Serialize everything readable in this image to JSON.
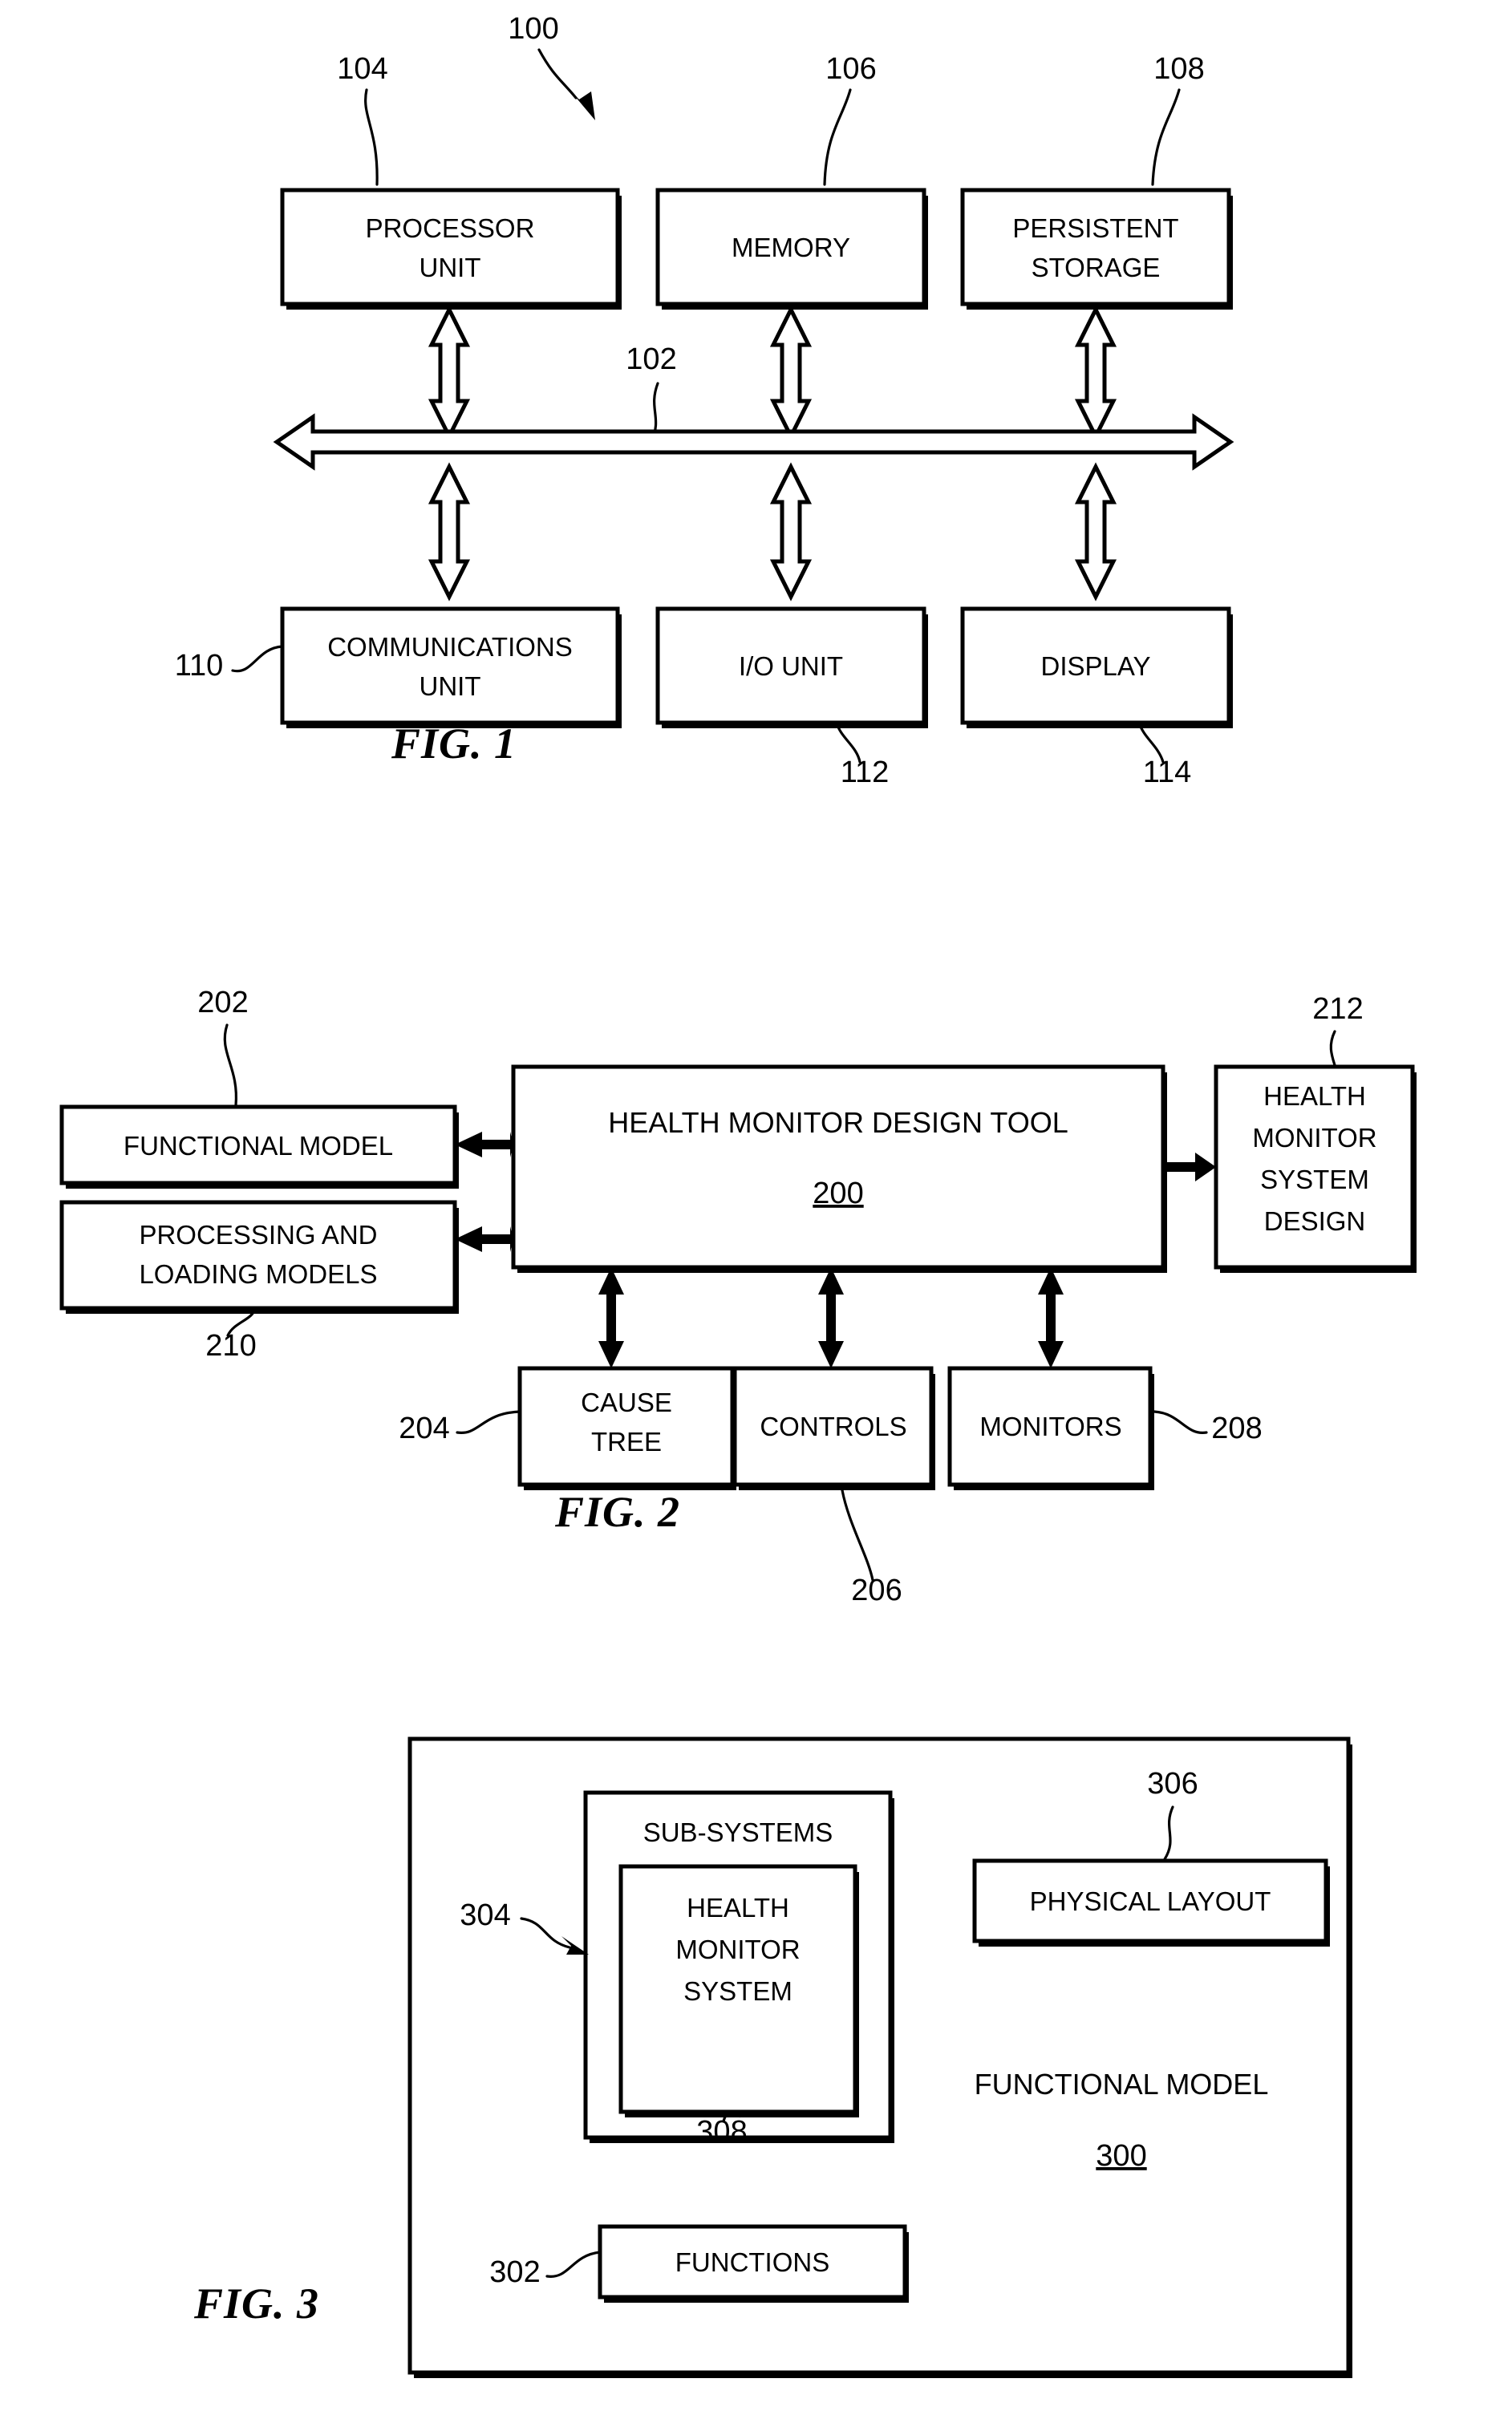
{
  "document": {
    "type": "patent-drawing-sheet",
    "figure_count": 3
  },
  "figures": [
    {
      "id": "fig1",
      "caption": "FIG. 1",
      "title_numeral": "100",
      "bus": {
        "numeral": "102"
      },
      "boxes": [
        {
          "numeral": "104",
          "lines": [
            "PROCESSOR",
            "UNIT"
          ],
          "row": "top"
        },
        {
          "numeral": "106",
          "lines": [
            "MEMORY"
          ],
          "row": "top"
        },
        {
          "numeral": "108",
          "lines": [
            "PERSISTENT",
            "STORAGE"
          ],
          "row": "top"
        },
        {
          "numeral": "110",
          "lines": [
            "COMMUNICATIONS",
            "UNIT"
          ],
          "row": "bottom"
        },
        {
          "numeral": "112",
          "lines": [
            "I/O UNIT"
          ],
          "row": "bottom"
        },
        {
          "numeral": "114",
          "lines": [
            "DISPLAY"
          ],
          "row": "bottom"
        }
      ]
    },
    {
      "id": "fig2",
      "caption": "FIG. 2",
      "center": {
        "numeral": "200",
        "label": "HEALTH MONITOR DESIGN TOOL"
      },
      "boxes": [
        {
          "numeral": "202",
          "lines": [
            "FUNCTIONAL MODEL"
          ],
          "position": "left-top"
        },
        {
          "numeral": "210",
          "lines": [
            "PROCESSING AND",
            "LOADING MODELS"
          ],
          "position": "left-bottom"
        },
        {
          "numeral": "212",
          "lines": [
            "HEALTH",
            "MONITOR",
            "SYSTEM",
            "DESIGN"
          ],
          "position": "right"
        },
        {
          "numeral": "204",
          "lines": [
            "CAUSE",
            "TREE"
          ],
          "position": "bottom-1"
        },
        {
          "numeral": "206",
          "lines": [
            "CONTROLS"
          ],
          "position": "bottom-2"
        },
        {
          "numeral": "208",
          "lines": [
            "MONITORS"
          ],
          "position": "bottom-3"
        }
      ]
    },
    {
      "id": "fig3",
      "caption": "FIG. 3",
      "container": {
        "numeral": "300",
        "label": "FUNCTIONAL MODEL"
      },
      "boxes": [
        {
          "numeral": "304",
          "lines": [
            "SUB-SYSTEMS"
          ],
          "position": "outer-nested"
        },
        {
          "numeral": "308",
          "lines": [
            "HEALTH",
            "MONITOR",
            "SYSTEM"
          ],
          "position": "inner-nested"
        },
        {
          "numeral": "306",
          "lines": [
            "PHYSICAL LAYOUT"
          ],
          "position": "right"
        },
        {
          "numeral": "302",
          "lines": [
            "FUNCTIONS"
          ],
          "position": "bottom-left"
        }
      ]
    }
  ],
  "colors": {
    "ink": "#000000",
    "paper": "#ffffff"
  }
}
